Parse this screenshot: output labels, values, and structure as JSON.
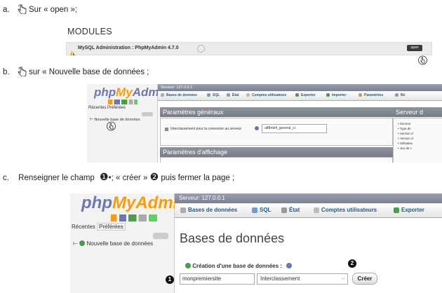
{
  "steps": {
    "a_prefix": "a.",
    "a_text": "Sur « open »;",
    "b_prefix": "b.",
    "b_text": "sur « Nouvelle base de données ;",
    "c_prefix": "c.",
    "c_text_1": "Renseigner le champ",
    "c_marker_1": "❶",
    "c_text_2": "•; « créer »",
    "c_marker_2": "❷",
    "c_text_3": "puis fermer la page ;"
  },
  "modules": {
    "title": "MODULES",
    "item": "MySQL Administration : PhpMyAdmin 4.7.0",
    "open_label": "open"
  },
  "pma": {
    "logo_php": "php",
    "logo_my": "MyAdmin",
    "logo_admin": "Admin",
    "recent": "Récentes",
    "favorites": "Préférées",
    "new_db": "Nouvelle base de données",
    "server": "Serveur: 127.0.0.1",
    "tabs": [
      "Bases de données",
      "SQL",
      "État",
      "Comptes utilisateurs",
      "Exporter",
      "Importer",
      "Paramètres",
      "Ré"
    ],
    "general_settings": "Paramètres généraux",
    "collation_label": "Interclassement pour la connexion au serveur",
    "collation_value": "utf8mb4_general_ci",
    "display_settings": "Paramètres d'affichage",
    "server_panel": "Serveur d",
    "server_list": [
      "Serveur",
      "Type de",
      "Version d",
      "Version d",
      "Utilisateu",
      "Jeu de c"
    ]
  },
  "shot_c": {
    "page_title": "Bases de données",
    "create_label": "Création d'une base de données :",
    "db_name_value": "monpremiersite",
    "collation_placeholder": "Interclassement",
    "create_button": "Créer",
    "badge_1": "1",
    "badge_2": "2"
  },
  "colors": {
    "pma_blue": "#6c78af",
    "pma_orange": "#f89c0e",
    "link_blue": "#235a81"
  }
}
